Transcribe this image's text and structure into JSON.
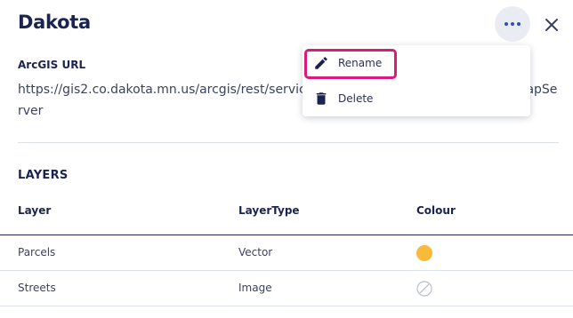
{
  "panel": {
    "title": "Dakota",
    "more_icon": "more-horizontal-icon",
    "close_icon": "close-icon"
  },
  "arcgis": {
    "label": "ArcGIS URL",
    "url": "https://gis2.co.dakota.mn.us/arcgis/rest/services/DCGIS_OL_Parcels_And_Roads/MapServer"
  },
  "layers": {
    "heading": "LAYERS",
    "columns": {
      "layer": "Layer",
      "type": "LayerType",
      "colour": "Colour"
    },
    "rows": [
      {
        "name": "Parcels",
        "type": "Vector",
        "colour": "#f9b93a",
        "colour_state": "filled"
      },
      {
        "name": "Streets",
        "type": "Image",
        "colour": "none",
        "colour_state": "no-colour"
      }
    ]
  },
  "menu": {
    "items": [
      {
        "label": "Rename",
        "icon": "pencil-icon",
        "focused": true
      },
      {
        "label": "Delete",
        "icon": "trash-icon",
        "focused": false
      }
    ]
  },
  "colors": {
    "accent": "#2c4ec7",
    "focus": "#d81b7c",
    "title": "#1b2450"
  }
}
